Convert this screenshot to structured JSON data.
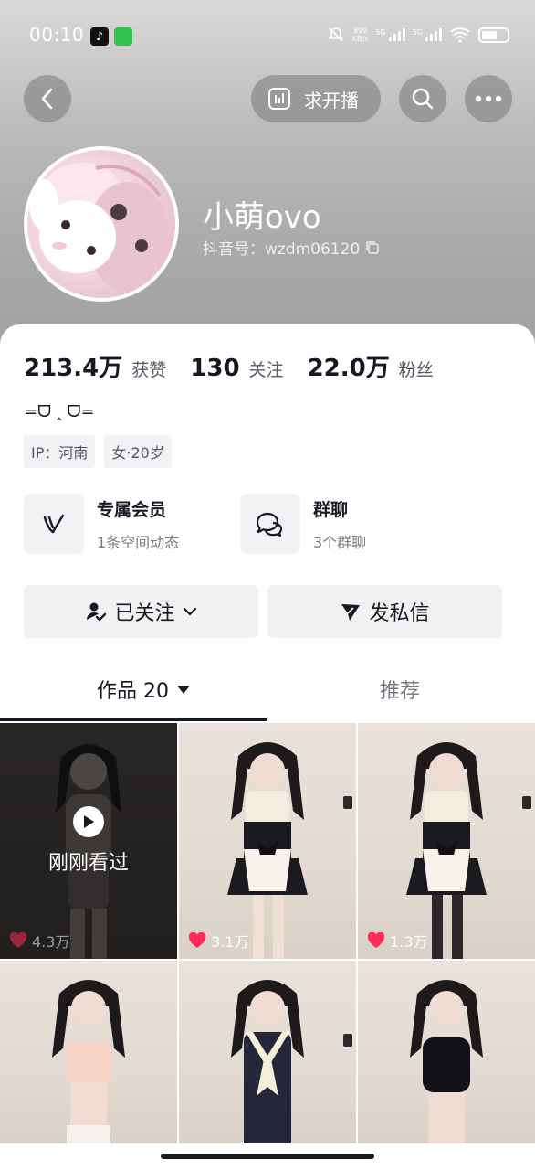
{
  "status_bar": {
    "time": "00:10",
    "net_speed_value": "890",
    "net_speed_unit": "KB/s",
    "signal1_label": "5G",
    "signal2_label": "5G"
  },
  "nav": {
    "live_request_label": "求开播"
  },
  "profile": {
    "name": "小萌ovo",
    "douyin_id": "抖音号：wzdm06120"
  },
  "stats": [
    {
      "value": "213.4万",
      "label": "获赞"
    },
    {
      "value": "130",
      "label": "关注"
    },
    {
      "value": "22.0万",
      "label": "粉丝"
    }
  ],
  "signature": "=ᗜ ‸ ᗜ=",
  "tags": [
    "IP：河南",
    "女·20岁"
  ],
  "features": {
    "membership": {
      "title": "专属会员",
      "subtitle": "1条空间动态"
    },
    "group_chat": {
      "title": "群聊",
      "subtitle": "3个群聊"
    }
  },
  "actions": {
    "follow_label": "已关注",
    "message_label": "发私信"
  },
  "tabs": {
    "works_label": "作品 20",
    "recommend_label": "推荐"
  },
  "grid": {
    "watched_label": "刚刚看过",
    "items": [
      {
        "likes": "4.3万"
      },
      {
        "likes": "3.1万"
      },
      {
        "likes": "1.3万"
      },
      {
        "likes": ""
      },
      {
        "likes": ""
      },
      {
        "likes": ""
      }
    ]
  }
}
